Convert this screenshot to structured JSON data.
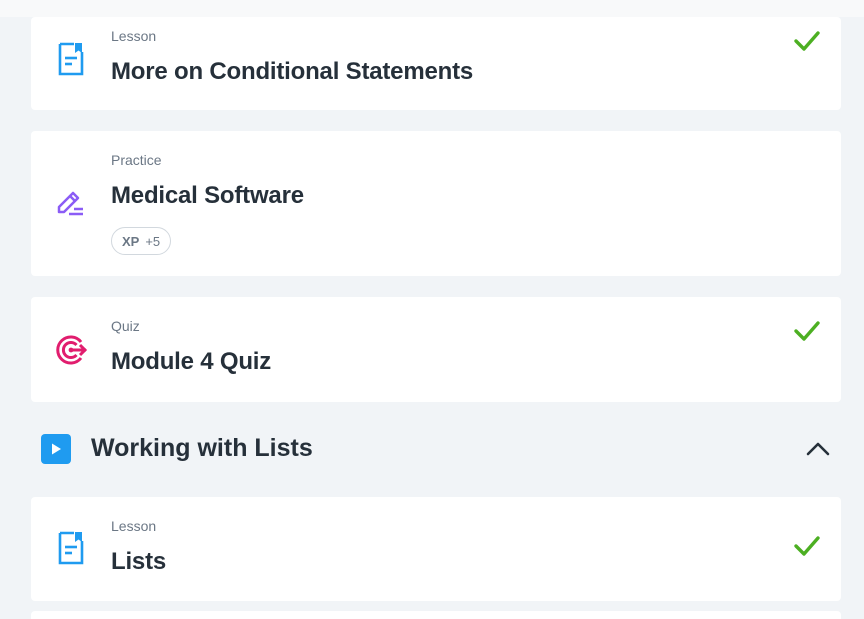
{
  "items": [
    {
      "type": "Lesson",
      "title": "More on Conditional Statements",
      "icon": "lesson-icon",
      "completed": true
    },
    {
      "type": "Practice",
      "title": "Medical Software",
      "icon": "pencil-icon",
      "xp_label": "XP",
      "xp_value": "+5",
      "completed": false
    },
    {
      "type": "Quiz",
      "title": "Module 4 Quiz",
      "icon": "target-icon",
      "completed": true
    }
  ],
  "section": {
    "title": "Working with Lists",
    "icon": "play-icon",
    "expanded": true
  },
  "section_items": [
    {
      "type": "Lesson",
      "title": "Lists",
      "icon": "lesson-icon",
      "completed": true
    }
  ],
  "colors": {
    "lesson": "#1f9bf0",
    "practice": "#8b5cf6",
    "quiz": "#e11d6e",
    "check": "#4caf22",
    "background": "#f1f4f7"
  }
}
